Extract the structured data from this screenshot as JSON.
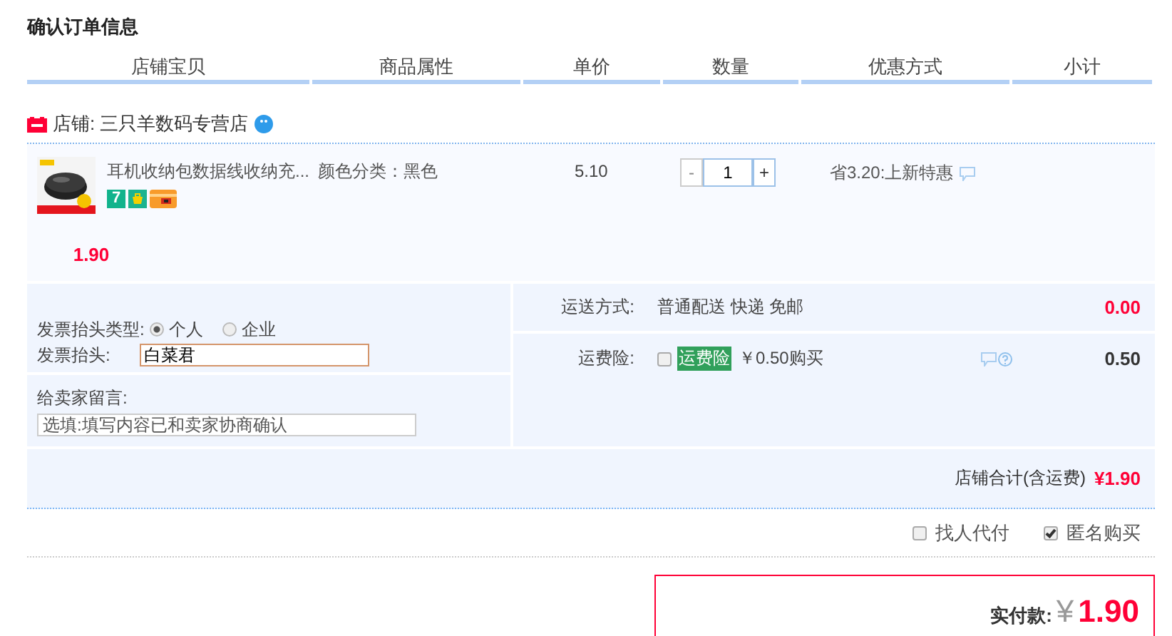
{
  "title": "确认订单信息",
  "columns": [
    "店铺宝贝",
    "商品属性",
    "单价",
    "数量",
    "优惠方式",
    "小计"
  ],
  "shop": {
    "label": "店铺: 三只羊数码专营店"
  },
  "item": {
    "name": "耳机收纳包数据线收纳充...",
    "attribute": "颜色分类：黑色",
    "badge": "7",
    "price": "5.10",
    "minus": "-",
    "quantity": "1",
    "plus": "+",
    "discount": "省3.20:上新特惠",
    "subtotal": "1.90"
  },
  "invoice": {
    "type_label": "发票抬头类型:",
    "options": [
      {
        "label": "个人",
        "selected": true
      },
      {
        "label": "企业",
        "selected": false
      }
    ],
    "title_label": "发票抬头:",
    "title_value": "白菜君"
  },
  "message": {
    "label": "给卖家留言:",
    "placeholder": "选填:填写内容已和卖家协商确认"
  },
  "shipping": {
    "label": "运送方式:",
    "value": "普通配送 快递 免邮",
    "amount": "0.00"
  },
  "insurance": {
    "label": "运费险:",
    "checked": false,
    "tag": "运费险",
    "price": "￥0.50购买",
    "amount": "0.50"
  },
  "shop_total": {
    "label": "店铺合计(含运费)",
    "amount": "¥1.90"
  },
  "options": [
    {
      "label": "找人代付",
      "checked": false
    },
    {
      "label": "匿名购买",
      "checked": true
    }
  ],
  "payment": {
    "label": "实付款:",
    "currency": "¥",
    "amount": "1.90"
  }
}
